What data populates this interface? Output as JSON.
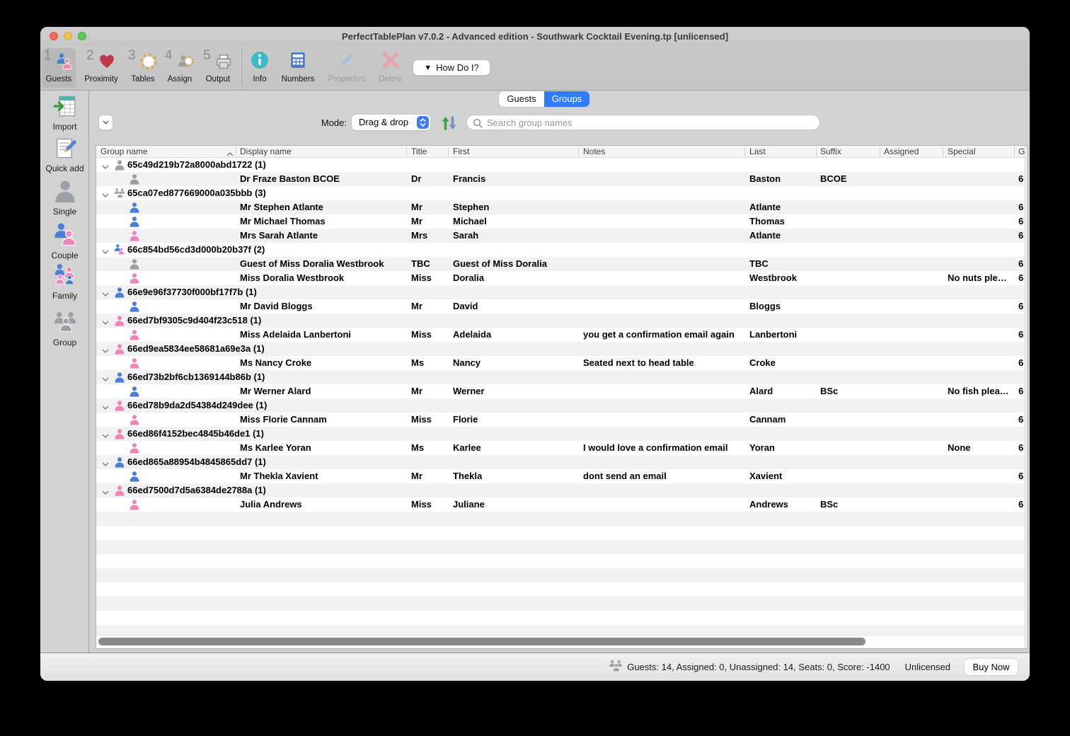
{
  "window_title": "PerfectTablePlan v7.0.2 - Advanced edition - Southwark Cocktail Evening.tp [unlicensed]",
  "toolbar": {
    "items": [
      {
        "number": "1",
        "label": "Guests",
        "icon": "couple",
        "selected": true,
        "disabled": false
      },
      {
        "number": "2",
        "label": "Proximity",
        "icon": "heart",
        "selected": false,
        "disabled": false
      },
      {
        "number": "3",
        "label": "Tables",
        "icon": "table",
        "selected": false,
        "disabled": false
      },
      {
        "number": "4",
        "label": "Assign",
        "icon": "assign",
        "selected": false,
        "disabled": false
      },
      {
        "number": "5",
        "label": "Output",
        "icon": "printer",
        "selected": false,
        "disabled": false
      },
      {
        "number": "",
        "label": "Info",
        "icon": "info",
        "selected": false,
        "disabled": false
      },
      {
        "number": "",
        "label": "Numbers",
        "icon": "calculator",
        "selected": false,
        "disabled": false
      },
      {
        "number": "",
        "label": "Properties",
        "icon": "pencil",
        "selected": false,
        "disabled": true
      },
      {
        "number": "",
        "label": "Delete",
        "icon": "delete-x",
        "selected": false,
        "disabled": true
      }
    ],
    "how_do_i_label": "How Do I?"
  },
  "sidebar": {
    "items": [
      {
        "label": "Import",
        "icon": "import-spreadsheet"
      },
      {
        "label": "Quick add",
        "icon": "quick-add-note"
      },
      {
        "label": "Single",
        "icon": "person-gray"
      },
      {
        "label": "Couple",
        "icon": "couple"
      },
      {
        "label": "Family",
        "icon": "family"
      },
      {
        "label": "Group",
        "icon": "people-gray"
      }
    ]
  },
  "tabs": [
    {
      "label": "Guests",
      "active": false
    },
    {
      "label": "Groups",
      "active": true
    }
  ],
  "controls": {
    "mode_label": "Mode:",
    "mode_value": "Drag & drop",
    "search_placeholder": "Search group names"
  },
  "table": {
    "columns": [
      "Group name",
      "Display name",
      "Title",
      "First",
      "Notes",
      "Last",
      "Suffix",
      "Assigned",
      "Special",
      "G"
    ],
    "sorted_column": "Group name",
    "groups": [
      {
        "id": "65c49d219b72a8000abd1722",
        "count": "1",
        "icon": "person-gray",
        "guests": [
          {
            "icon": "person-gray",
            "display": "Dr Fraze Baston BCOE",
            "title": "Dr",
            "first": "Francis",
            "notes": "",
            "last": "Baston",
            "suffix": "BCOE",
            "assigned": "",
            "special": "",
            "g": "6"
          }
        ]
      },
      {
        "id": "65ca07ed877669000a035bbb",
        "count": "3",
        "icon": "people-gray",
        "guests": [
          {
            "icon": "person-blue",
            "display": "Mr Stephen Atlante",
            "title": "Mr",
            "first": "Stephen",
            "notes": "",
            "last": "Atlante",
            "suffix": "",
            "assigned": "",
            "special": "",
            "g": "6"
          },
          {
            "icon": "person-blue",
            "display": "Mr Michael Thomas",
            "title": "Mr",
            "first": "Michael",
            "notes": "",
            "last": "Thomas",
            "suffix": "",
            "assigned": "",
            "special": "",
            "g": "6"
          },
          {
            "icon": "person-pink",
            "display": "Mrs Sarah Atlante",
            "title": "Mrs",
            "first": "Sarah",
            "notes": "",
            "last": "Atlante",
            "suffix": "",
            "assigned": "",
            "special": "",
            "g": "6"
          }
        ]
      },
      {
        "id": "66c854bd56cd3d000b20b37f",
        "count": "2",
        "icon": "couple",
        "guests": [
          {
            "icon": "person-gray",
            "display": "Guest of Miss Doralia Westbrook",
            "title": "TBC",
            "first": "Guest of Miss Doralia",
            "notes": "",
            "last": "TBC",
            "suffix": "",
            "assigned": "",
            "special": "",
            "g": "6"
          },
          {
            "icon": "person-pink",
            "display": "Miss Doralia Westbrook",
            "title": "Miss",
            "first": "Doralia",
            "notes": "",
            "last": "Westbrook",
            "suffix": "",
            "assigned": "",
            "special": "No nuts ple…",
            "g": "6"
          }
        ]
      },
      {
        "id": "66e9e96f37730f000bf17f7b",
        "count": "1",
        "icon": "person-blue",
        "guests": [
          {
            "icon": "person-blue",
            "display": "Mr David Bloggs",
            "title": "Mr",
            "first": "David",
            "notes": "",
            "last": "Bloggs",
            "suffix": "",
            "assigned": "",
            "special": "",
            "g": "6"
          }
        ]
      },
      {
        "id": "66ed7bf9305c9d404f23c518",
        "count": "1",
        "icon": "person-pink",
        "guests": [
          {
            "icon": "person-pink",
            "display": "Miss Adelaida Lanbertoni",
            "title": "Miss",
            "first": "Adelaida",
            "notes": "you get a confirmation email again",
            "last": "Lanbertoni",
            "suffix": "",
            "assigned": "",
            "special": "",
            "g": "6"
          }
        ]
      },
      {
        "id": "66ed9ea5834ee58681a69e3a",
        "count": "1",
        "icon": "person-pink",
        "guests": [
          {
            "icon": "person-pink",
            "display": "Ms Nancy Croke",
            "title": "Ms",
            "first": "Nancy",
            "notes": "Seated next to head table",
            "last": "Croke",
            "suffix": "",
            "assigned": "",
            "special": "",
            "g": "6"
          }
        ]
      },
      {
        "id": "66ed73b2bf6cb1369144b86b",
        "count": "1",
        "icon": "person-blue",
        "guests": [
          {
            "icon": "person-blue",
            "display": "Mr Werner Alard",
            "title": "Mr",
            "first": "Werner",
            "notes": "",
            "last": "Alard",
            "suffix": "BSc",
            "assigned": "",
            "special": "No fish plea…",
            "g": "6"
          }
        ]
      },
      {
        "id": "66ed78b9da2d54384d249dee",
        "count": "1",
        "icon": "person-pink",
        "guests": [
          {
            "icon": "person-pink",
            "display": "Miss Florie Cannam",
            "title": "Miss",
            "first": "Florie",
            "notes": "",
            "last": "Cannam",
            "suffix": "",
            "assigned": "",
            "special": "",
            "g": "6"
          }
        ]
      },
      {
        "id": "66ed86f4152bec4845b46de1",
        "count": "1",
        "icon": "person-pink",
        "guests": [
          {
            "icon": "person-pink",
            "display": "Ms Karlee Yoran",
            "title": "Ms",
            "first": "Karlee",
            "notes": "I would love a confirmation email",
            "last": "Yoran",
            "suffix": "",
            "assigned": "",
            "special": "None",
            "g": "6"
          }
        ]
      },
      {
        "id": "66ed865a88954b4845865dd7",
        "count": "1",
        "icon": "person-blue",
        "guests": [
          {
            "icon": "person-blue",
            "display": "Mr Thekla Xavient",
            "title": "Mr",
            "first": "Thekla",
            "notes": "dont send an email",
            "last": "Xavient",
            "suffix": "",
            "assigned": "",
            "special": "",
            "g": "6"
          }
        ]
      },
      {
        "id": "66ed7500d7d5a6384de2788a",
        "count": "1",
        "icon": "person-pink",
        "guests": [
          {
            "icon": "person-pink",
            "display": "Julia Andrews",
            "title": "Miss",
            "first": "Juliane",
            "notes": "",
            "last": "Andrews",
            "suffix": "BSc",
            "assigned": "",
            "special": "",
            "g": "6"
          }
        ]
      }
    ]
  },
  "status_bar": {
    "summary": "Guests: 14, Assigned: 0, Unassigned: 14, Seats: 0, Score: -1400",
    "license": "Unlicensed",
    "buy_now_label": "Buy Now"
  }
}
